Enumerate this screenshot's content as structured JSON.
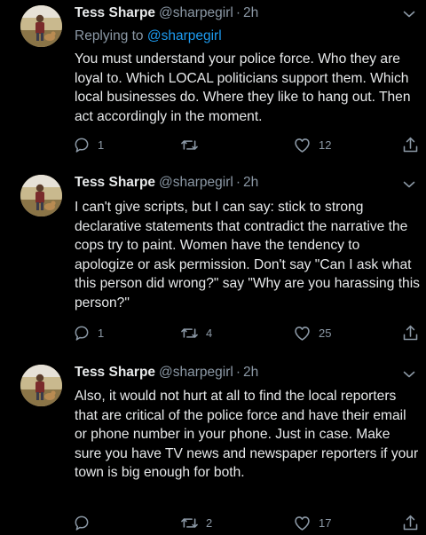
{
  "tweets": [
    {
      "name": "Tess Sharpe",
      "handle": "@sharpegirl",
      "separator": "·",
      "time": "2h",
      "replying_prefix": "Replying to",
      "replying_handle": "@sharpegirl",
      "text": "You must understand your police force. Who they are loyal to. Which LOCAL politicians support them. Which local businesses do. Where they like to hang out. Then act accordingly in the moment.",
      "reply_count": "1",
      "retweet_count": "",
      "like_count": "12"
    },
    {
      "name": "Tess Sharpe",
      "handle": "@sharpegirl",
      "separator": "·",
      "time": "2h",
      "text": "I can't give scripts, but I can say: stick to strong declarative statements that contradict the narrative the cops try to paint. Women have the tendency to apologize or ask permission. Don't say \"Can I ask what this person did wrong?\" say \"Why are you harassing this person?\"",
      "reply_count": "1",
      "retweet_count": "4",
      "like_count": "25"
    },
    {
      "name": "Tess Sharpe",
      "handle": "@sharpegirl",
      "separator": "·",
      "time": "2h",
      "text": "Also, it would not hurt at all to find the local reporters that are critical of the police force and have their email or phone number in your phone. Just in case. Make sure you have TV news and newspaper reporters if your town is big enough for both.",
      "reply_count": "",
      "retweet_count": "2",
      "like_count": "17"
    }
  ],
  "icons": {
    "reply": "reply-icon",
    "retweet": "retweet-icon",
    "like": "heart-icon",
    "share": "share-icon",
    "menu": "chevron-down-icon"
  },
  "colors": {
    "background": "#000000",
    "text": "#e7e9ea",
    "muted": "#8b98a5",
    "link": "#1d9bf0"
  }
}
